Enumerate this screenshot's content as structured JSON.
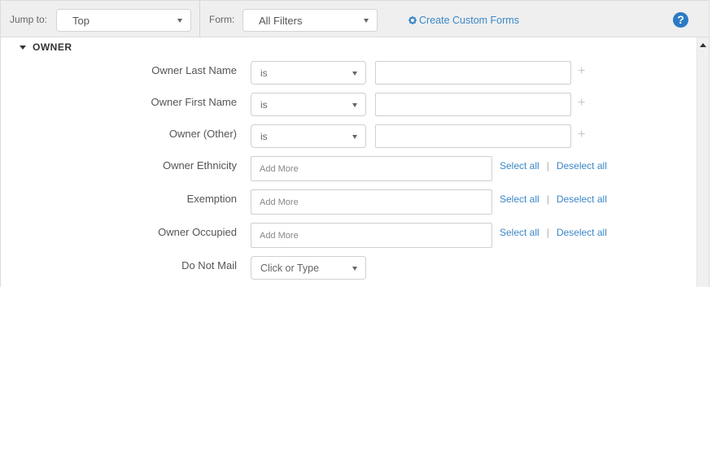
{
  "toolbar": {
    "jump_to_label": "Jump to:",
    "jump_to_value": "Top",
    "form_label": "Form:",
    "form_value": "All Filters",
    "create_custom_forms": "Create Custom Forms",
    "help_glyph": "?"
  },
  "section": {
    "title": "OWNER"
  },
  "rows": {
    "owner_last_name": {
      "label": "Owner Last Name",
      "operator": "is",
      "value": ""
    },
    "owner_first_name": {
      "label": "Owner First Name",
      "operator": "is",
      "value": ""
    },
    "owner_other": {
      "label": "Owner (Other)",
      "operator": "is",
      "value": ""
    },
    "owner_ethnicity": {
      "label": "Owner Ethnicity",
      "placeholder": "Add More"
    },
    "exemption": {
      "label": "Exemption",
      "placeholder": "Add More"
    },
    "owner_occupied": {
      "label": "Owner Occupied",
      "placeholder": "Add More"
    },
    "do_not_mail": {
      "label": "Do Not Mail",
      "value": "Click or Type"
    }
  },
  "links": {
    "select_all": "Select all",
    "separator": "|",
    "deselect_all": "Deselect all"
  },
  "icons": {
    "add": "+"
  },
  "colors": {
    "accent": "#3a87c8",
    "help": "#2a7bc4",
    "toolbar_bg": "#efefef"
  }
}
